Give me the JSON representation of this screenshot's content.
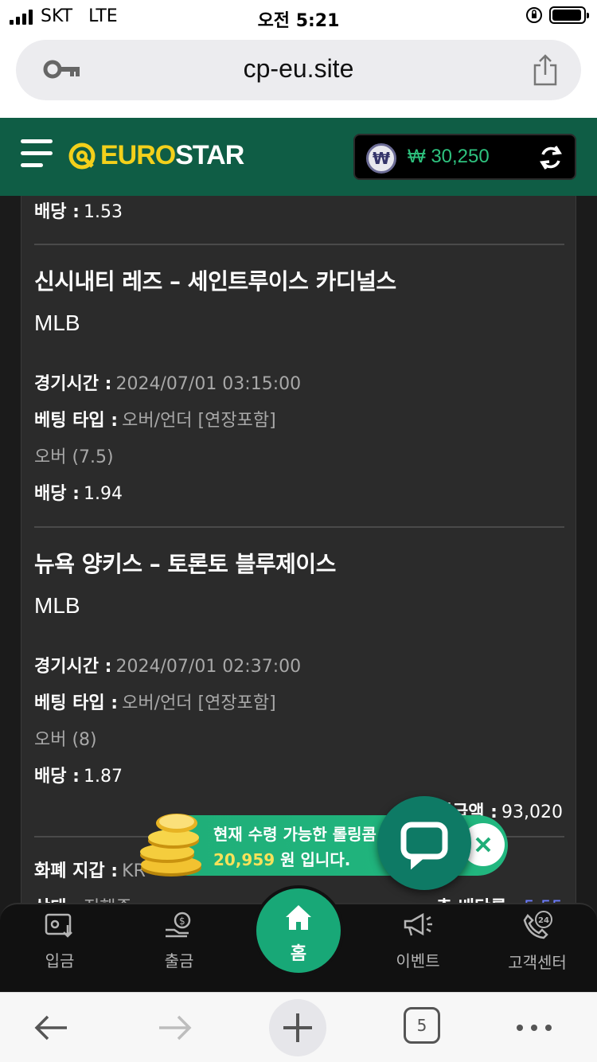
{
  "status_bar": {
    "carrier": "SKT",
    "network": "LTE",
    "time": "오전 5:21"
  },
  "browser": {
    "url": "cp-eu.site",
    "tab_count": "5"
  },
  "header": {
    "logo_part1": "EURO",
    "logo_part2": "STAR",
    "balance": "₩ 30,250",
    "currency_symbol": "₩",
    "accent_color": "#0f5d45"
  },
  "content": {
    "prev_odds_label": "배당 :",
    "prev_odds_value": "1.53",
    "bets": [
      {
        "match": "신시내티 레즈 – 세인트루이스 카디널스",
        "league": "MLB",
        "time_label": "경기시간 :",
        "time_value": "2024/07/01 03:15:00",
        "type_label": "베팅 타입 :",
        "type_value": "오버/언더 [연장포함]",
        "pick": "오버 (7.5)",
        "odds_label": "배당 :",
        "odds_value": "1.94"
      },
      {
        "match": "뉴욕 양키스 – 토론토 블루제이스",
        "league": "MLB",
        "time_label": "경기시간 :",
        "time_value": "2024/07/01 02:37:00",
        "type_label": "베팅 타입 :",
        "type_value": "오버/언더 [연장포함]",
        "pick": "오버 (8)",
        "odds_label": "배당 :",
        "odds_value": "1.87"
      }
    ],
    "payout_label": "지급액 :",
    "payout_value": "93,020",
    "wallet_label": "화폐 지갑 :",
    "wallet_value": "KR",
    "status_label": "상태 :",
    "status_value": "진행중",
    "total_odds_label": "총 배당률 :",
    "total_odds_value": "5.55"
  },
  "promo": {
    "line1": "현재 수령 가능한 롤링콤",
    "amount": "20,959",
    "line2_suffix": "원 입니다."
  },
  "bottom_nav": {
    "deposit": "입금",
    "withdraw": "출금",
    "home": "홈",
    "event": "이벤트",
    "support": "고객센터",
    "support_badge": "24"
  }
}
